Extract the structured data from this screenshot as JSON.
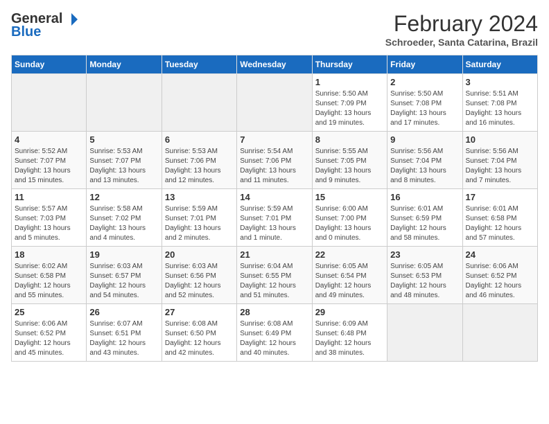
{
  "header": {
    "logo_general": "General",
    "logo_blue": "Blue",
    "month_title": "February 2024",
    "location": "Schroeder, Santa Catarina, Brazil"
  },
  "calendar": {
    "days_of_week": [
      "Sunday",
      "Monday",
      "Tuesday",
      "Wednesday",
      "Thursday",
      "Friday",
      "Saturday"
    ],
    "weeks": [
      [
        {
          "day": "",
          "info": ""
        },
        {
          "day": "",
          "info": ""
        },
        {
          "day": "",
          "info": ""
        },
        {
          "day": "",
          "info": ""
        },
        {
          "day": "1",
          "info": "Sunrise: 5:50 AM\nSunset: 7:09 PM\nDaylight: 13 hours and 19 minutes."
        },
        {
          "day": "2",
          "info": "Sunrise: 5:50 AM\nSunset: 7:08 PM\nDaylight: 13 hours and 17 minutes."
        },
        {
          "day": "3",
          "info": "Sunrise: 5:51 AM\nSunset: 7:08 PM\nDaylight: 13 hours and 16 minutes."
        }
      ],
      [
        {
          "day": "4",
          "info": "Sunrise: 5:52 AM\nSunset: 7:07 PM\nDaylight: 13 hours and 15 minutes."
        },
        {
          "day": "5",
          "info": "Sunrise: 5:53 AM\nSunset: 7:07 PM\nDaylight: 13 hours and 13 minutes."
        },
        {
          "day": "6",
          "info": "Sunrise: 5:53 AM\nSunset: 7:06 PM\nDaylight: 13 hours and 12 minutes."
        },
        {
          "day": "7",
          "info": "Sunrise: 5:54 AM\nSunset: 7:06 PM\nDaylight: 13 hours and 11 minutes."
        },
        {
          "day": "8",
          "info": "Sunrise: 5:55 AM\nSunset: 7:05 PM\nDaylight: 13 hours and 9 minutes."
        },
        {
          "day": "9",
          "info": "Sunrise: 5:56 AM\nSunset: 7:04 PM\nDaylight: 13 hours and 8 minutes."
        },
        {
          "day": "10",
          "info": "Sunrise: 5:56 AM\nSunset: 7:04 PM\nDaylight: 13 hours and 7 minutes."
        }
      ],
      [
        {
          "day": "11",
          "info": "Sunrise: 5:57 AM\nSunset: 7:03 PM\nDaylight: 13 hours and 5 minutes."
        },
        {
          "day": "12",
          "info": "Sunrise: 5:58 AM\nSunset: 7:02 PM\nDaylight: 13 hours and 4 minutes."
        },
        {
          "day": "13",
          "info": "Sunrise: 5:59 AM\nSunset: 7:01 PM\nDaylight: 13 hours and 2 minutes."
        },
        {
          "day": "14",
          "info": "Sunrise: 5:59 AM\nSunset: 7:01 PM\nDaylight: 13 hours and 1 minute."
        },
        {
          "day": "15",
          "info": "Sunrise: 6:00 AM\nSunset: 7:00 PM\nDaylight: 13 hours and 0 minutes."
        },
        {
          "day": "16",
          "info": "Sunrise: 6:01 AM\nSunset: 6:59 PM\nDaylight: 12 hours and 58 minutes."
        },
        {
          "day": "17",
          "info": "Sunrise: 6:01 AM\nSunset: 6:58 PM\nDaylight: 12 hours and 57 minutes."
        }
      ],
      [
        {
          "day": "18",
          "info": "Sunrise: 6:02 AM\nSunset: 6:58 PM\nDaylight: 12 hours and 55 minutes."
        },
        {
          "day": "19",
          "info": "Sunrise: 6:03 AM\nSunset: 6:57 PM\nDaylight: 12 hours and 54 minutes."
        },
        {
          "day": "20",
          "info": "Sunrise: 6:03 AM\nSunset: 6:56 PM\nDaylight: 12 hours and 52 minutes."
        },
        {
          "day": "21",
          "info": "Sunrise: 6:04 AM\nSunset: 6:55 PM\nDaylight: 12 hours and 51 minutes."
        },
        {
          "day": "22",
          "info": "Sunrise: 6:05 AM\nSunset: 6:54 PM\nDaylight: 12 hours and 49 minutes."
        },
        {
          "day": "23",
          "info": "Sunrise: 6:05 AM\nSunset: 6:53 PM\nDaylight: 12 hours and 48 minutes."
        },
        {
          "day": "24",
          "info": "Sunrise: 6:06 AM\nSunset: 6:52 PM\nDaylight: 12 hours and 46 minutes."
        }
      ],
      [
        {
          "day": "25",
          "info": "Sunrise: 6:06 AM\nSunset: 6:52 PM\nDaylight: 12 hours and 45 minutes."
        },
        {
          "day": "26",
          "info": "Sunrise: 6:07 AM\nSunset: 6:51 PM\nDaylight: 12 hours and 43 minutes."
        },
        {
          "day": "27",
          "info": "Sunrise: 6:08 AM\nSunset: 6:50 PM\nDaylight: 12 hours and 42 minutes."
        },
        {
          "day": "28",
          "info": "Sunrise: 6:08 AM\nSunset: 6:49 PM\nDaylight: 12 hours and 40 minutes."
        },
        {
          "day": "29",
          "info": "Sunrise: 6:09 AM\nSunset: 6:48 PM\nDaylight: 12 hours and 38 minutes."
        },
        {
          "day": "",
          "info": ""
        },
        {
          "day": "",
          "info": ""
        }
      ]
    ]
  }
}
